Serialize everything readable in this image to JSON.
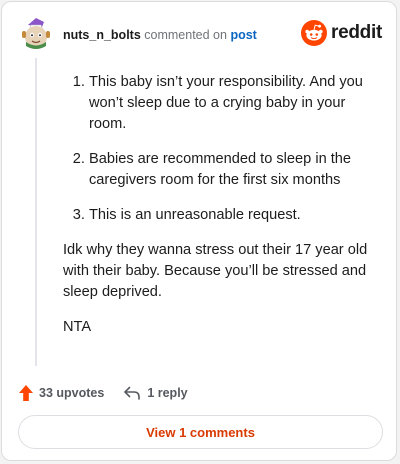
{
  "header": {
    "username": "nuts_n_bolts",
    "commented_text": "commented on",
    "post_link": "post",
    "brand": "reddit"
  },
  "comment": {
    "list_items": [
      "This baby isn’t your responsibility. And you won’t sleep due to a crying baby in your room.",
      "Babies are recommended to sleep in the caregivers room for the first six months",
      "This is an unreasonable request."
    ],
    "paragraphs": [
      "Idk why they wanna stress out their 17 year old with their baby. Because you’ll be stressed and sleep deprived.",
      "NTA"
    ]
  },
  "actions": {
    "upvotes": "33 upvotes",
    "replies": "1 reply"
  },
  "footer": {
    "view_button": "View 1 comments"
  },
  "colors": {
    "brand_orange": "#ff4500",
    "link_blue": "#0b66c3",
    "button_text": "#d93a00"
  },
  "icons": {
    "avatar": "user-avatar",
    "logo": "reddit-snoo-icon",
    "upvote": "upvote-arrow-icon",
    "reply": "reply-arrow-icon"
  }
}
